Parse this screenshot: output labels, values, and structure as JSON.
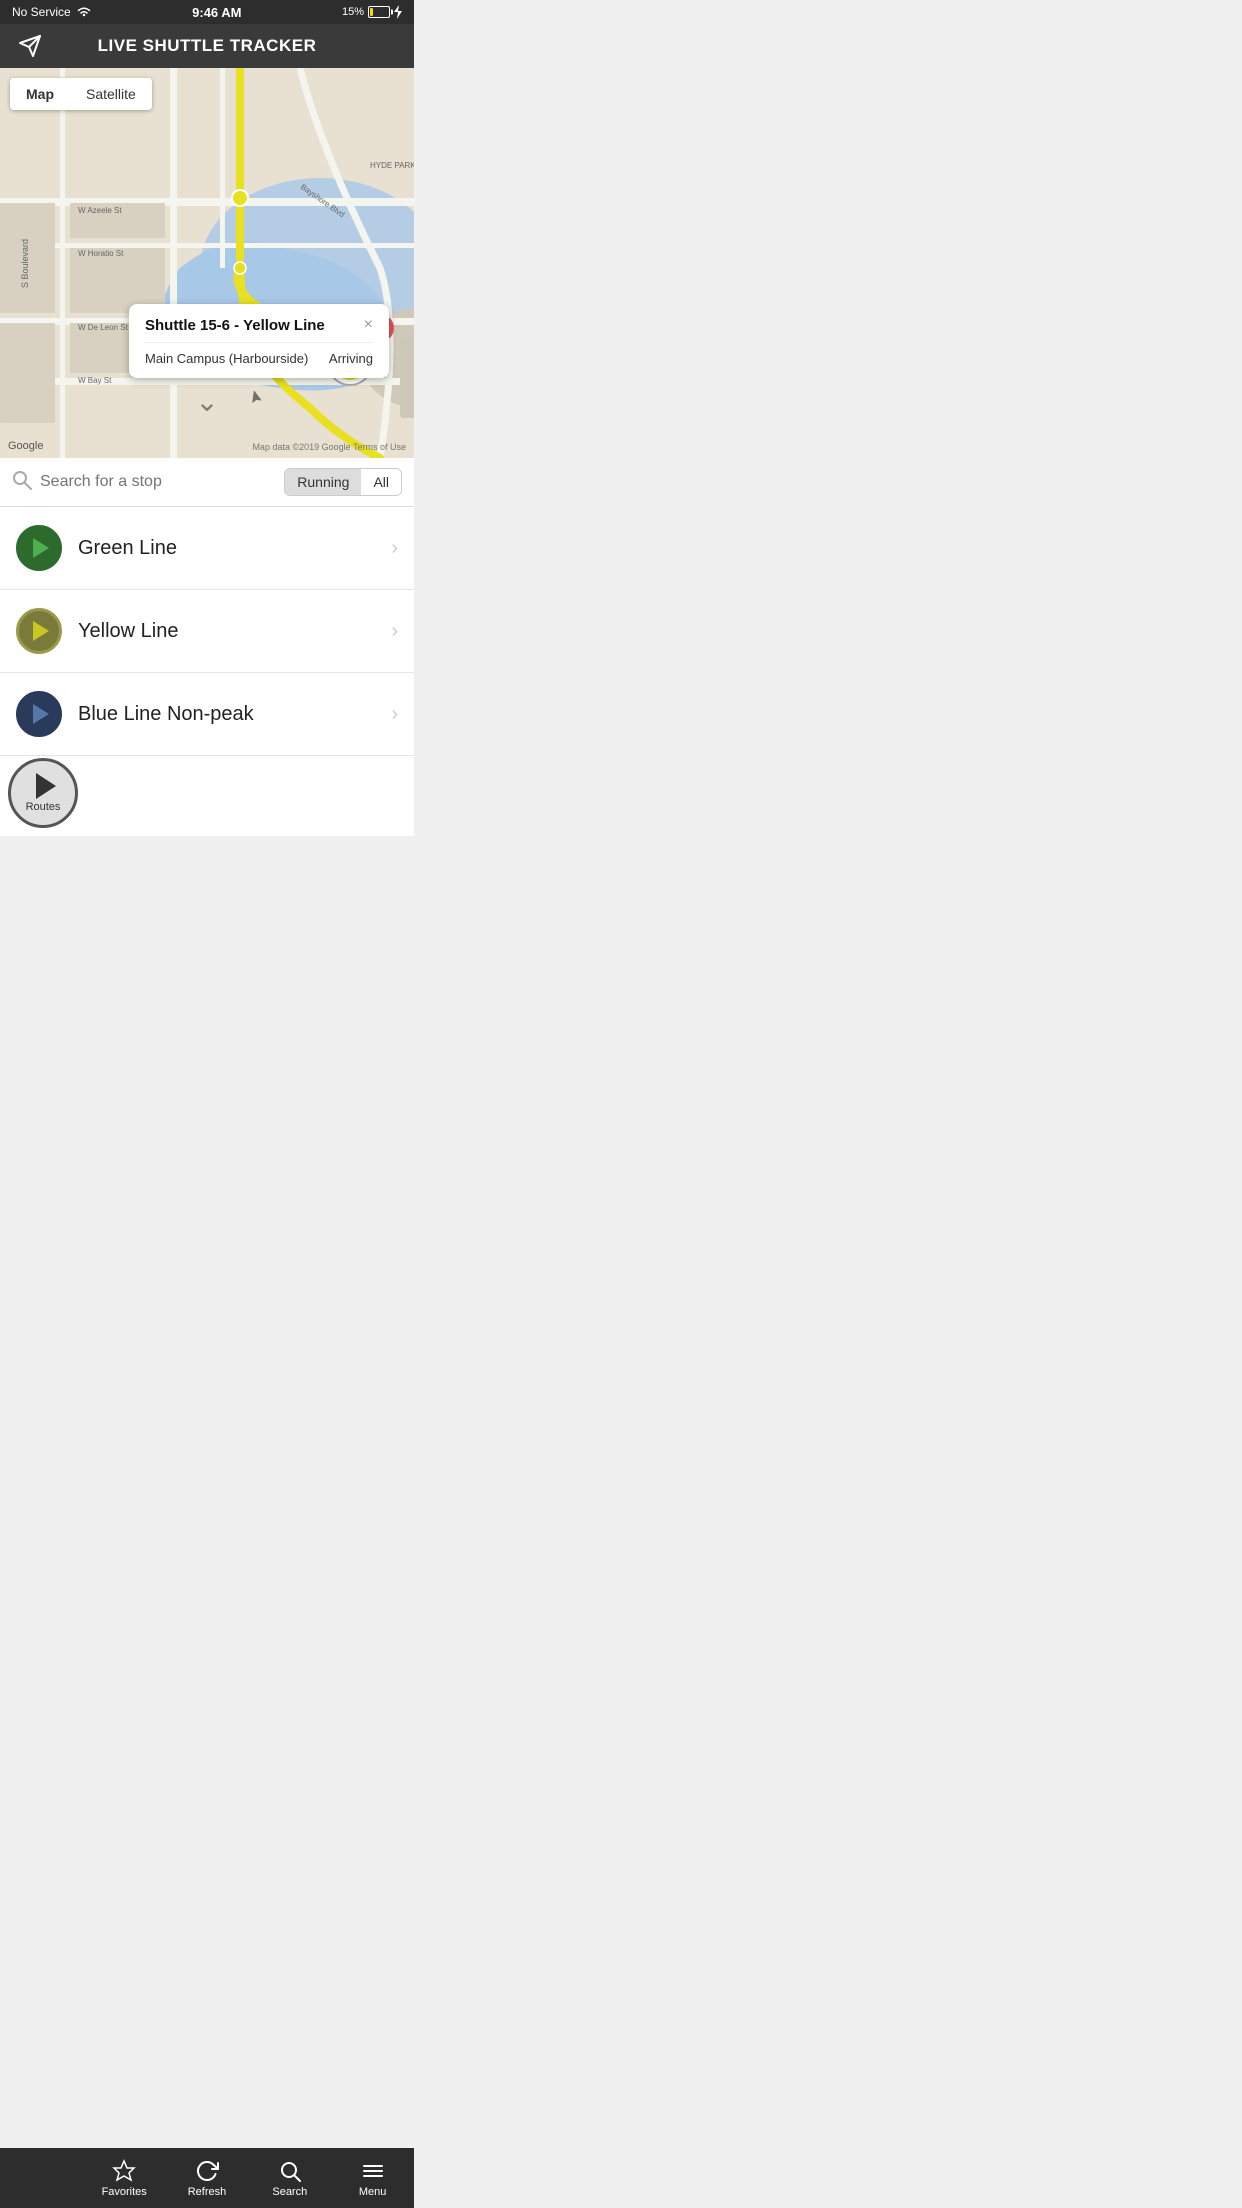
{
  "statusBar": {
    "carrier": "No Service",
    "time": "9:46 AM",
    "battery": "15%"
  },
  "header": {
    "title": "LIVE SHUTTLE TRACKER",
    "iconLabel": "location-arrow-icon"
  },
  "mapToggle": {
    "options": [
      "Map",
      "Satellite"
    ],
    "active": "Map"
  },
  "infoPopup": {
    "title": "Shuttle 15-6 - Yellow Line",
    "stop": "Main Campus (Harbourside)",
    "status": "Arriving",
    "closeLabel": "×"
  },
  "searchBar": {
    "placeholder": "Search for a stop",
    "filters": [
      "Running",
      "All"
    ],
    "activeFilter": "Running"
  },
  "routes": [
    {
      "name": "Green Line",
      "color": "green",
      "borderColor": "#2d6b2d",
      "bgColor": "#2d6b2d",
      "playColor": "#4caf50"
    },
    {
      "name": "Yellow Line",
      "color": "yellow",
      "borderColor": "#9a9a4a",
      "bgColor": "#7a7a3a",
      "playColor": "#c8c820"
    },
    {
      "name": "Blue Line Non-peak",
      "color": "blue",
      "borderColor": "#2a3a5a",
      "bgColor": "#2a3a5a",
      "playColor": "#5577aa"
    }
  ],
  "bottomNav": {
    "items": [
      {
        "id": "routes",
        "label": "Routes",
        "icon": "play"
      },
      {
        "id": "favorites",
        "label": "Favorites",
        "icon": "star"
      },
      {
        "id": "refresh",
        "label": "Refresh",
        "icon": "refresh"
      },
      {
        "id": "search",
        "label": "Search",
        "icon": "search"
      },
      {
        "id": "menu",
        "label": "Menu",
        "icon": "menu"
      }
    ]
  },
  "map": {
    "googleLabel": "Google",
    "copyright": "Map data ©2019 Google   Terms of Use"
  }
}
